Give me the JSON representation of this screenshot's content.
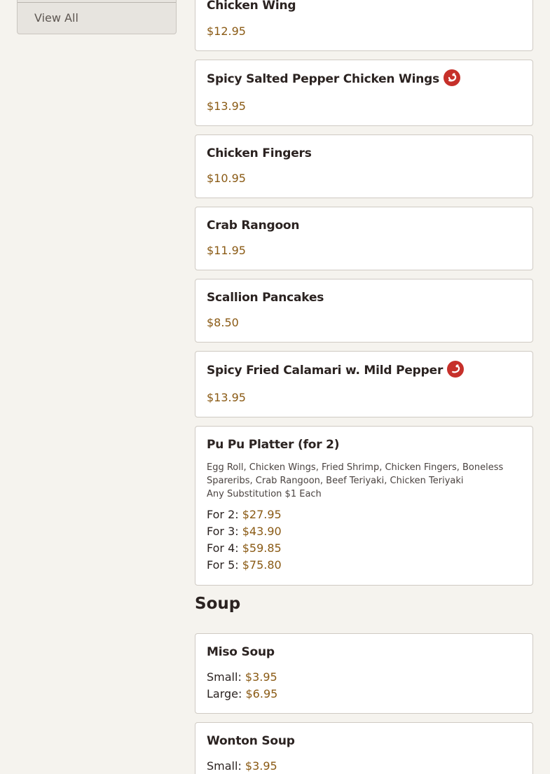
{
  "sidebar": {
    "view_all_label": "View All"
  },
  "items": [
    {
      "name": "Chicken Wing",
      "price": "$12.95"
    },
    {
      "name": "Spicy Salted Pepper Chicken Wings",
      "price": "$13.95",
      "spicy": true
    },
    {
      "name": "Chicken Fingers",
      "price": "$10.95"
    },
    {
      "name": "Crab Rangoon",
      "price": "$11.95"
    },
    {
      "name": "Scallion Pancakes",
      "price": "$8.50"
    },
    {
      "name": "Spicy Fried Calamari w. Mild Pepper",
      "price": "$13.95",
      "spicy": true
    },
    {
      "name": "Pu Pu Platter (for 2)",
      "description": [
        "Egg Roll, Chicken Wings, Fried Shrimp, Chicken Fingers, Boneless",
        "Spareribs, Crab Rangoon, Beef Teriyaki, Chicken Teriyaki",
        "Any Substitution $1 Each"
      ],
      "options": [
        {
          "label": "For 2:",
          "price": "$27.95"
        },
        {
          "label": "For 3:",
          "price": "$43.90"
        },
        {
          "label": "For 4:",
          "price": "$59.85"
        },
        {
          "label": "For 5:",
          "price": "$75.80"
        }
      ]
    }
  ],
  "soup_section": {
    "title": "Soup",
    "items": [
      {
        "name": "Miso Soup",
        "options": [
          {
            "label": "Small:",
            "price": "$3.95"
          },
          {
            "label": "Large:",
            "price": "$6.95"
          }
        ]
      },
      {
        "name": "Wonton Soup",
        "options": [
          {
            "label": "Small:",
            "price": "$3.95"
          }
        ]
      }
    ]
  },
  "colors": {
    "background": "#f5f3ee",
    "price": "#8a5a14",
    "spicy_icon": "#c6302a"
  },
  "icons": {
    "spicy": "chili-pepper-icon"
  }
}
